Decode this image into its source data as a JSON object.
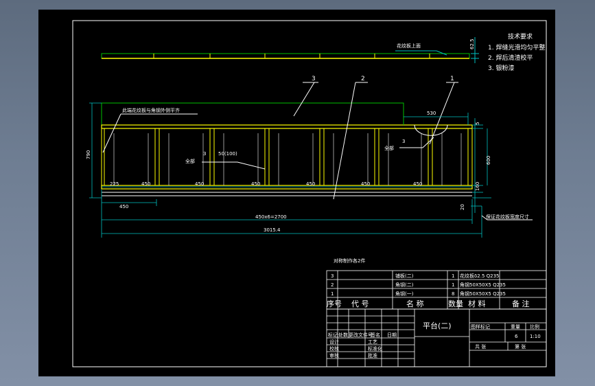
{
  "colors": {
    "background_outer": "#6e7d92",
    "sheet": "#000000",
    "frame": "#ffffff",
    "member": "#ffff00",
    "plate": "#00c000",
    "dimension": "#00c0c0",
    "text": "#ffffff"
  },
  "drawing": {
    "top_view_note": "花纹板上面",
    "dim_top_thickness": "62.5",
    "weld_note": "此端花纹板与角钢外侧平齐",
    "leader_labels": [
      "3",
      "2",
      "1"
    ],
    "callout_left_number": "3",
    "callout_left_size": "50(100)",
    "callout_left_text": "全部",
    "callout_right_number": "3",
    "callout_right_text": "全部",
    "dim_overhang": "530",
    "dim_height_total": "790",
    "dim_height_inner": "600",
    "dim_right_top": "5",
    "dim_right_bottom": "160",
    "dim_bottom_offset": "20",
    "dim_first_bay": "225",
    "dim_bays": [
      "450",
      "450",
      "450",
      "450",
      "450",
      "450"
    ],
    "dim_first_span": "450",
    "dim_total_frame": "450x6=2700",
    "dim_total_length": "3015.4",
    "right_note": "保证花纹板宽度尺寸",
    "tech_req": {
      "title": "技术要求",
      "items": [
        "1. 焊缝光滑均匀平整",
        "2. 焊后清渣校平",
        "3. 银粉漆"
      ]
    }
  },
  "table": {
    "note": "对称制作各2件",
    "rows": [
      {
        "no": "3",
        "code": "",
        "name": "铺板(二)",
        "qty": "1",
        "material": "花纹板δ2.5 Q235",
        "remark": ""
      },
      {
        "no": "2",
        "code": "",
        "name": "角钢(二)",
        "qty": "1",
        "material": "角钢50X50X5 Q235",
        "remark": ""
      },
      {
        "no": "1",
        "code": "",
        "name": "角钢(一)",
        "qty": "8",
        "material": "角钢50X50X5 Q235",
        "remark": ""
      }
    ],
    "header": {
      "no": "序号",
      "code": "代 号",
      "name": "名 称",
      "qty": "数量",
      "material": "材 料",
      "remark": "备 注"
    }
  },
  "title_block": {
    "title": "平台(二)",
    "left_labels": [
      "设计",
      "校核",
      "审核",
      "工艺",
      "标准化",
      "批准"
    ],
    "sign_labels": [
      "标记",
      "处数",
      "更改文件号",
      "签名",
      "日期"
    ],
    "right_labels": {
      "stage": "图样标记",
      "weight": "重量",
      "scale": "比例"
    },
    "weight_value": "6",
    "scale_value": "1:10",
    "sheet_total": "共  张",
    "sheet_no": "第  张"
  }
}
